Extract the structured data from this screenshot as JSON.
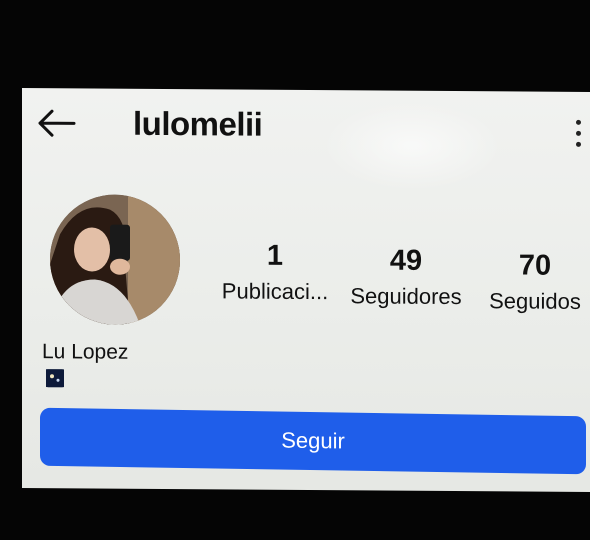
{
  "header": {
    "back_icon": "arrow-left-icon",
    "username": "lulomelii",
    "more_icon": "more-vertical-icon"
  },
  "profile": {
    "display_name": "Lu Lopez",
    "badge_icon": "flag-badge-icon"
  },
  "stats": {
    "posts": {
      "value": "1",
      "label": "Publicaci..."
    },
    "followers": {
      "value": "49",
      "label": "Seguidores"
    },
    "following": {
      "value": "70",
      "label": "Seguidos"
    }
  },
  "actions": {
    "follow_label": "Seguir"
  },
  "colors": {
    "button": "#1f5eea",
    "background": "#eceeeb",
    "text": "#111111"
  }
}
